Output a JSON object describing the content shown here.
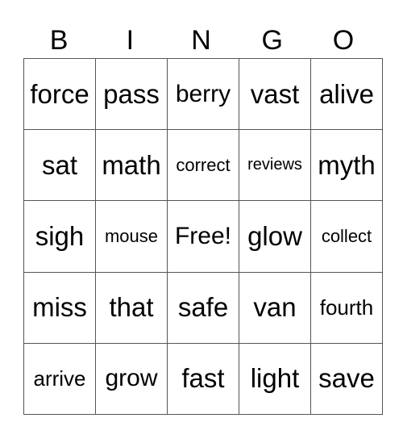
{
  "header": {
    "letters": [
      "B",
      "I",
      "N",
      "G",
      "O"
    ]
  },
  "board": {
    "rows": [
      [
        "force",
        "pass",
        "berry",
        "vast",
        "alive"
      ],
      [
        "sat",
        "math",
        "correct",
        "reviews",
        "myth"
      ],
      [
        "sigh",
        "mouse",
        "Free!",
        "glow",
        "collect"
      ],
      [
        "miss",
        "that",
        "safe",
        "van",
        "fourth"
      ],
      [
        "arrive",
        "grow",
        "fast",
        "light",
        "save"
      ]
    ]
  }
}
